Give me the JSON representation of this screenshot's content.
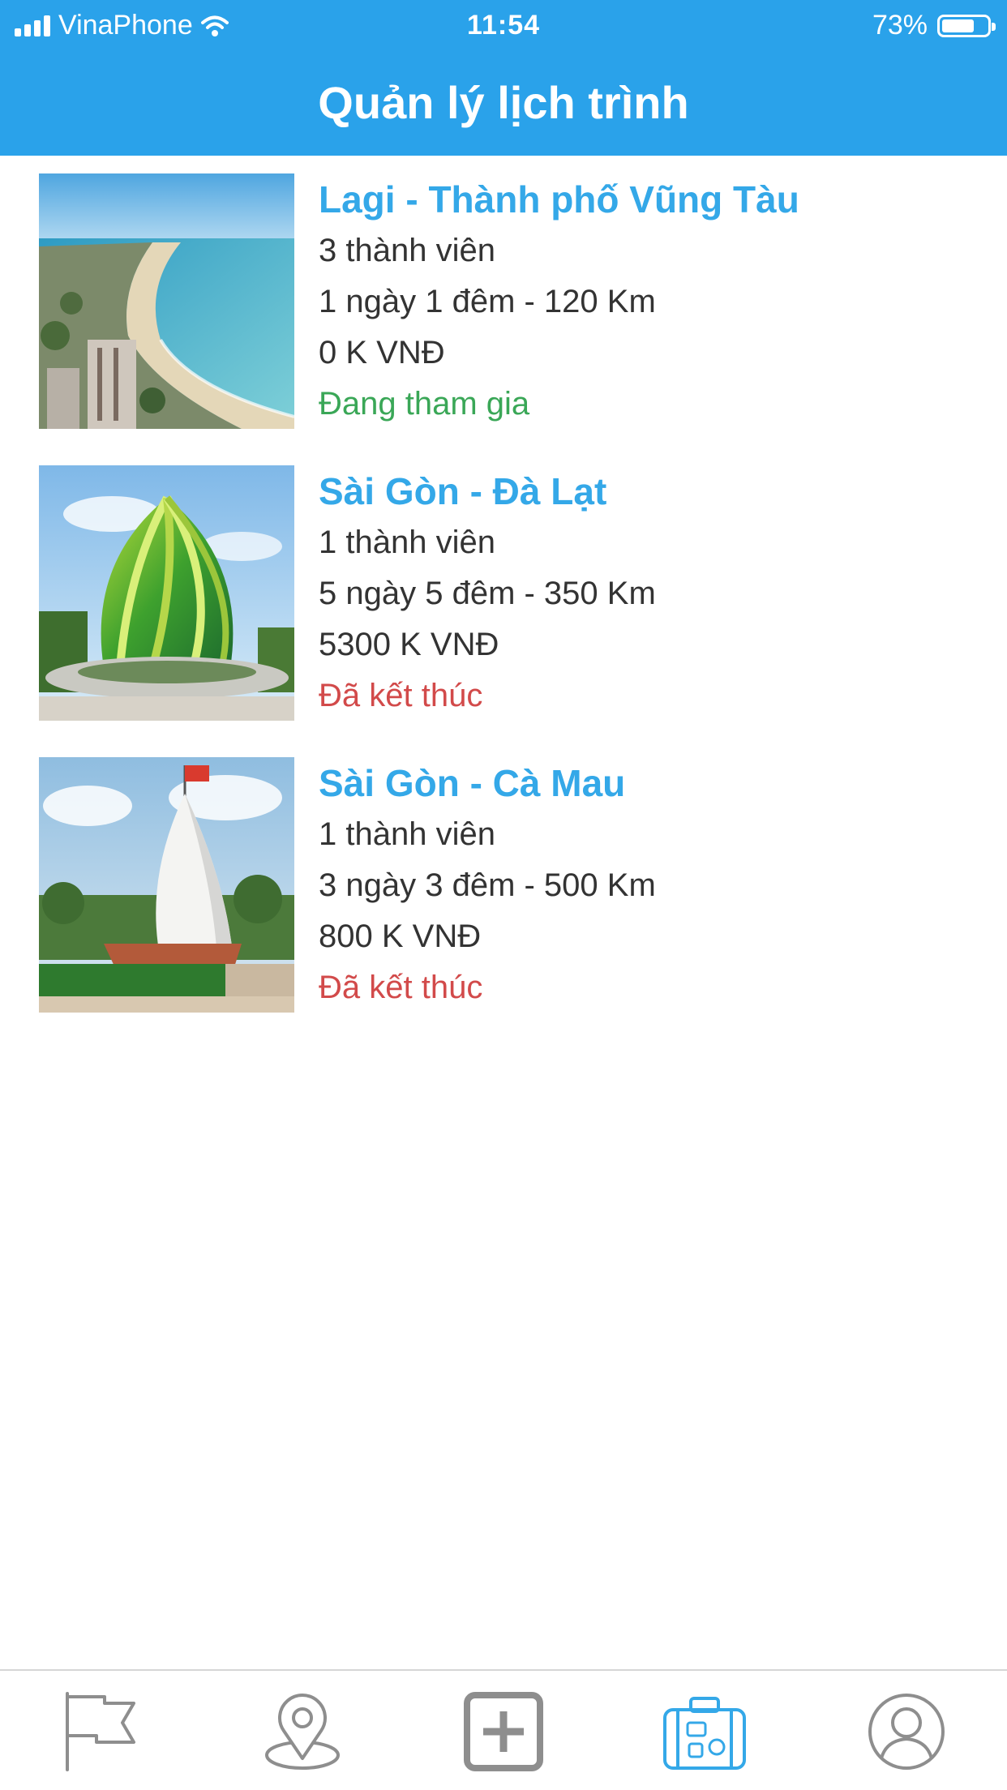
{
  "status_bar": {
    "carrier": "VinaPhone",
    "time": "11:54",
    "battery": "73%",
    "battery_level": 0.73,
    "icons": [
      "signal-icon",
      "wifi-icon",
      "battery-icon"
    ]
  },
  "header": {
    "title": "Quản lý lịch trình"
  },
  "trips": [
    {
      "name": "Lagi - Thành phố Vũng Tàu",
      "members": "3 thành viên",
      "duration": "1 ngày 1 đêm - 120 Km",
      "cost": "0 K VNĐ",
      "status": "Đang tham gia",
      "status_type": "active",
      "image": "beach-city-photo"
    },
    {
      "name": "Sài Gòn - Đà Lạt",
      "members": "1 thành viên",
      "duration": "5 ngày 5 đêm - 350 Km",
      "cost": "5300 K VNĐ",
      "status": "Đã kết thúc",
      "status_type": "ended",
      "image": "glass-flower-building-photo"
    },
    {
      "name": "Sài Gòn - Cà Mau",
      "members": "1 thành viên",
      "duration": "3 ngày 3 đêm - 500 Km",
      "cost": "800 K VNĐ",
      "status": "Đã kết thúc",
      "status_type": "ended",
      "image": "ca-mau-monument-photo"
    }
  ],
  "tab_bar": {
    "tabs": [
      {
        "icon": "flag-icon",
        "active": false
      },
      {
        "icon": "map-pin-icon",
        "active": false
      },
      {
        "icon": "add-icon",
        "active": false
      },
      {
        "icon": "suitcase-icon",
        "active": true
      },
      {
        "icon": "profile-icon",
        "active": false
      }
    ],
    "colors": {
      "active": "#34a8e8",
      "inactive": "#8e8e8e"
    }
  },
  "colors": {
    "primary": "#2aa2ea",
    "trip_title": "#34a8e8",
    "status_active": "#3aa757",
    "status_ended": "#d24a4a"
  }
}
